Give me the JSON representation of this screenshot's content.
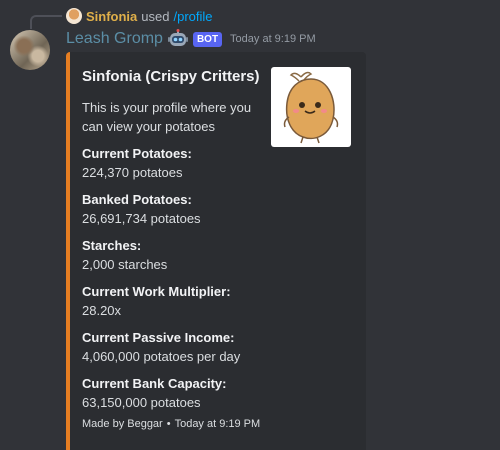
{
  "reply": {
    "user": "Sinfonia",
    "used": "used",
    "command": "/profile"
  },
  "message": {
    "username": "Leash Gromp",
    "bot_badge": "BOT",
    "timestamp": "Today at 9:19 PM"
  },
  "embed": {
    "accent_color": "#e67e22",
    "title": "Sinfonia (Crispy Critters)",
    "description": "This is your profile where you can view your potatoes",
    "fields": [
      {
        "name": "Current Potatoes:",
        "value": "224,370 potatoes"
      },
      {
        "name": "Banked Potatoes:",
        "value": "26,691,734 potatoes"
      },
      {
        "name": "Starches:",
        "value": "2,000 starches"
      },
      {
        "name": "Current Work Multiplier:",
        "value": "28.20x"
      },
      {
        "name": "Current Passive Income:",
        "value": "4,060,000 potatoes per day"
      },
      {
        "name": "Current Bank Capacity:",
        "value": "63,150,000 potatoes"
      }
    ],
    "footer": {
      "text": "Made by Beggar",
      "separator": "•",
      "timestamp": "Today at 9:19 PM"
    },
    "thumbnail_icon": "potato-character-icon"
  }
}
